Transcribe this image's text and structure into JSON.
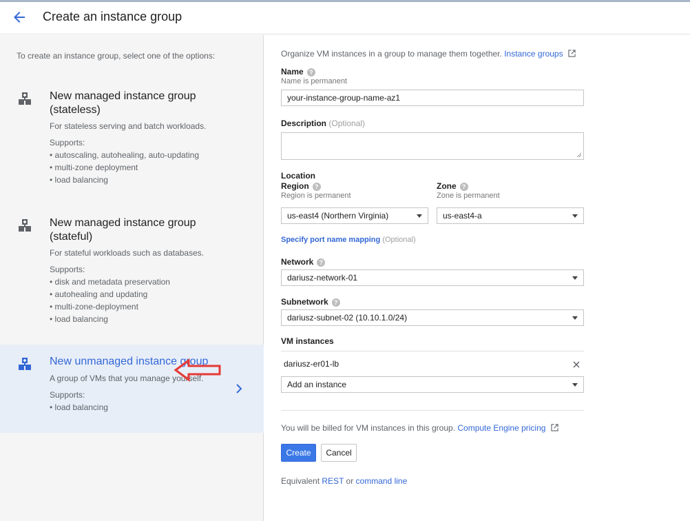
{
  "header": {
    "title": "Create an instance group"
  },
  "left": {
    "intro": "To create an instance group, select one of the options:",
    "options": [
      {
        "title_line1": "New managed instance group",
        "title_line2": "(stateless)",
        "desc": "For stateless serving and batch workloads.",
        "supports_label": "Supports:",
        "supports": [
          "• autoscaling, autohealing, auto-updating",
          "• multi-zone deployment",
          "• load balancing"
        ]
      },
      {
        "title_line1": "New managed instance group",
        "title_line2": "(stateful)",
        "desc": "For stateful workloads such as databases.",
        "supports_label": "Supports:",
        "supports": [
          "• disk and metadata preservation",
          "• autohealing and updating",
          "• multi-zone-deployment",
          "• load balancing"
        ]
      },
      {
        "title_line1": "New unmanaged instance group",
        "desc": "A group of VMs that you manage yourself.",
        "supports_label": "Supports:",
        "supports": [
          "• load balancing"
        ]
      }
    ]
  },
  "form": {
    "intro": "Organize VM instances in a group to manage them together.",
    "intro_link": "Instance groups",
    "name_label": "Name",
    "name_hint": "Name is permanent",
    "name_value": "your-instance-group-name-az1",
    "description_label": "Description",
    "optional": "(Optional)",
    "location_label": "Location",
    "region_label": "Region",
    "region_hint": "Region is permanent",
    "region_value": "us-east4 (Northern Virginia)",
    "zone_label": "Zone",
    "zone_hint": "Zone is permanent",
    "zone_value": "us-east4-a",
    "port_mapping_link": "Specify port name mapping",
    "network_label": "Network",
    "network_value": "dariusz-network-01",
    "subnetwork_label": "Subnetwork",
    "subnetwork_value": "dariusz-subnet-02 (10.10.1.0/24)",
    "vm_instances_label": "VM instances",
    "vm_instance_item": "dariusz-er01-lb",
    "add_instance": "Add an instance",
    "billing_text": "You will be billed for VM instances in this group.",
    "billing_link": "Compute Engine pricing",
    "create_label": "Create",
    "cancel_label": "Cancel",
    "equivalent_text": "Equivalent",
    "rest_link": "REST",
    "or_text": "or",
    "command_line_link": "command line"
  },
  "colors": {
    "accent": "#3367d6",
    "selected_bg": "#e8eef8",
    "arrow_red": "#e53935"
  }
}
